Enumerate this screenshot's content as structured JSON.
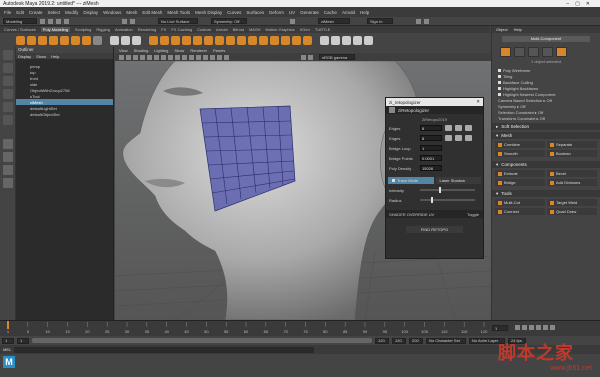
{
  "window": {
    "title": "Autodesk Maya 2019.2: untitled*  ---  ziMesh"
  },
  "menubar": {
    "items": [
      "File",
      "Edit",
      "Create",
      "Select",
      "Modify",
      "Display",
      "Windows",
      "Mesh",
      "Edit Mesh",
      "Mesh Tools",
      "Mesh Display",
      "Curves",
      "Surfaces",
      "Deform",
      "UV",
      "Generate",
      "Cache",
      "Arnold",
      "Help"
    ]
  },
  "status_line": {
    "menu_set": "Modeling",
    "live_surface": "No Live Surface",
    "symmetry": "Symmetry: Off",
    "object_name": "ziMesh",
    "sign_in": "Sign In"
  },
  "shelf": {
    "tabs": [
      "Curves / Surfaces",
      "Poly Modeling",
      "Sculpting",
      "Rigging",
      "Animation",
      "Rendering",
      "FX",
      "FX Caching",
      "Custom",
      "Arnold",
      "Bifrost",
      "MASH",
      "Motion Graphics",
      "XGen",
      "TURTLE"
    ],
    "active_tab": "Poly Modeling"
  },
  "outliner": {
    "title": "Outliner",
    "menu": [
      "Display",
      "Show",
      "Help"
    ],
    "items": [
      "persp",
      "top",
      "front",
      "side",
      "ObjectWithGroup2758",
      "uTool",
      "ziMesh",
      "defaultLightSet",
      "defaultObjectSet"
    ],
    "selected": "ziMesh"
  },
  "viewport": {
    "menu": [
      "View",
      "Shading",
      "Lighting",
      "Show",
      "Renderer",
      "Panels"
    ],
    "gamma": "sRGB gamma"
  },
  "zimesh_panel": {
    "title": "zi_retopologizer",
    "header": "ziRetopologizer",
    "subheader": "ZiRetopo2019",
    "fields": [
      {
        "label": "Edges",
        "value": "8"
      },
      {
        "label": "Edges",
        "value": "8"
      },
      {
        "label": "Bridge Loop",
        "value": "1"
      },
      {
        "label": "Bridge Points",
        "value": "0.0001"
      },
      {
        "label": "Poly Density",
        "value": "15026"
      }
    ],
    "tabs": [
      "Trace Mode",
      "Laser Shadow"
    ],
    "sliders": [
      "Intensity",
      "Radius"
    ],
    "shader_label": "SHADER OVERRIDE UV",
    "toggle_label": "Toggle",
    "footer": "FIND RETOPO"
  },
  "attribute_panel": {
    "tabs": [
      "Object",
      "Help"
    ],
    "multi_button": "Multi-Component",
    "selected_count": "1 object selected",
    "options": [
      "Poly Wireframe",
      "Tiling",
      "Backface Culling",
      "Highlight Backfaces",
      "Highlight Nearest Component"
    ],
    "camera_based": "Camera Based Selection  ▸  Off",
    "symmetry": "Symmetry  ▸  Off",
    "selection_constraint": "Selection Constraint  ▸  Off",
    "transform_constraint": "Transform Constraint  ▸  Off",
    "soft_selection": "Soft Selection",
    "sections": [
      {
        "name": "Mesh",
        "buttons": [
          "Combine",
          "Separate",
          "Smooth",
          "Boolean"
        ]
      },
      {
        "name": "Components",
        "buttons": [
          "Extrude",
          "Bevel",
          "Bridge",
          "Add Divisions"
        ]
      },
      {
        "name": "Tools",
        "buttons": [
          "Multi-Cut",
          "Target Weld",
          "Connect",
          "Quad Draw"
        ]
      }
    ]
  },
  "timeline": {
    "ticks": [
      "1",
      "5",
      "10",
      "15",
      "20",
      "25",
      "30",
      "35",
      "40",
      "45",
      "50",
      "55",
      "60",
      "65",
      "70",
      "75",
      "80",
      "85",
      "90",
      "95",
      "100",
      "105",
      "110",
      "115",
      "120"
    ],
    "current_frame": "1"
  },
  "range": {
    "start": "1",
    "start2": "1",
    "end": "120",
    "end2": "120",
    "end3": "200",
    "character_set": "No Character Set",
    "anim_layer": "No Anim Layer",
    "fps": "24 fps"
  },
  "command_line": {
    "lang": "MEL"
  },
  "watermark": {
    "cn": "脚本之家",
    "url": "www.jb51.net"
  },
  "colors": {
    "accent": "#d8862a",
    "selection": "#5285a6",
    "mesh": "#5b5fae"
  }
}
